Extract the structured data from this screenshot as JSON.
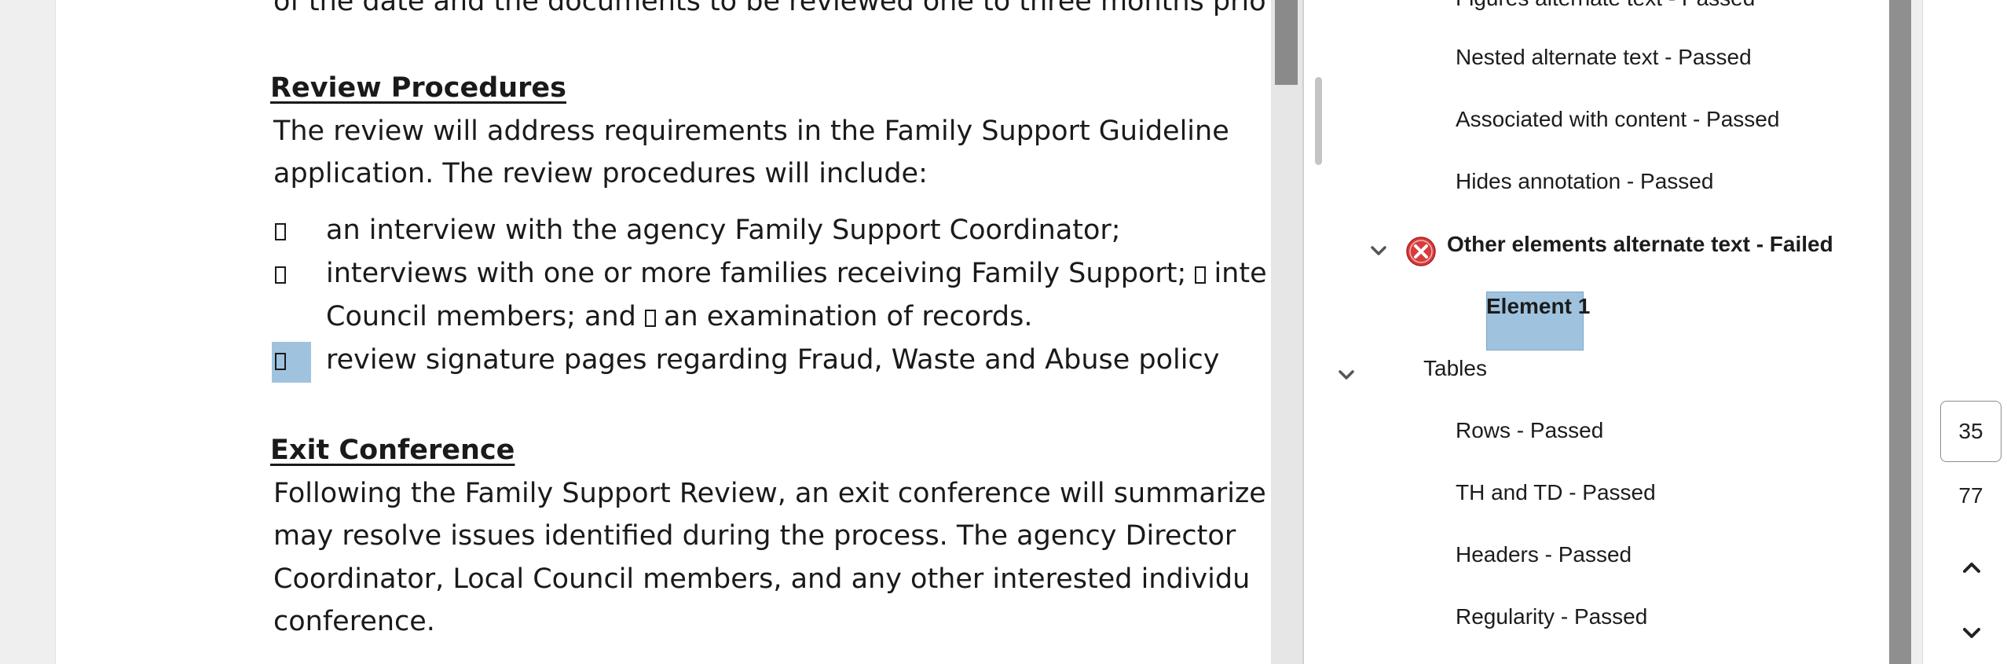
{
  "document": {
    "top_line": "of the date and the documents to be reviewed one to three months prio",
    "review_heading": "Review Procedures",
    "review_para": [
      "The review will address requirements in the Family Support Guideline",
      "application. The review procedures will include:"
    ],
    "bullets": [
      {
        "lines": [
          "an interview with the agency Family Support Coordinator;"
        ]
      },
      {
        "lines": [
          "interviews with one or more families receiving Family Support; ",
          "inte",
          "Council members; and ",
          "an examination of records."
        ]
      },
      {
        "lines": [
          "review signature pages regarding Fraud, Waste and Abuse policy"
        ]
      }
    ],
    "exit_heading": "Exit Conference",
    "exit_para": [
      "Following the Family Support Review, an exit conference will summarize",
      "may resolve issues identified during the process. The agency Director",
      "Coordinator, Local Council members, and any other interested individu",
      "conference."
    ]
  },
  "checker": {
    "items": [
      {
        "label": "Figures alternate text - Passed"
      },
      {
        "label": "Nested alternate text - Passed"
      },
      {
        "label": "Associated with content - Passed"
      },
      {
        "label": "Hides annotation - Passed"
      },
      {
        "label": "Other elements alternate text - Failed",
        "status": "failed"
      },
      {
        "label": "Element 1",
        "selected": true
      },
      {
        "label": "Tables"
      },
      {
        "label": "Rows - Passed"
      },
      {
        "label": "TH and TD - Passed"
      },
      {
        "label": "Headers - Passed"
      },
      {
        "label": "Regularity - Passed"
      }
    ]
  },
  "pager": {
    "current_page": "35",
    "total_pages": "77"
  },
  "colors": {
    "selection": "#9fc3df",
    "failed_icon": "#d83b3b"
  }
}
